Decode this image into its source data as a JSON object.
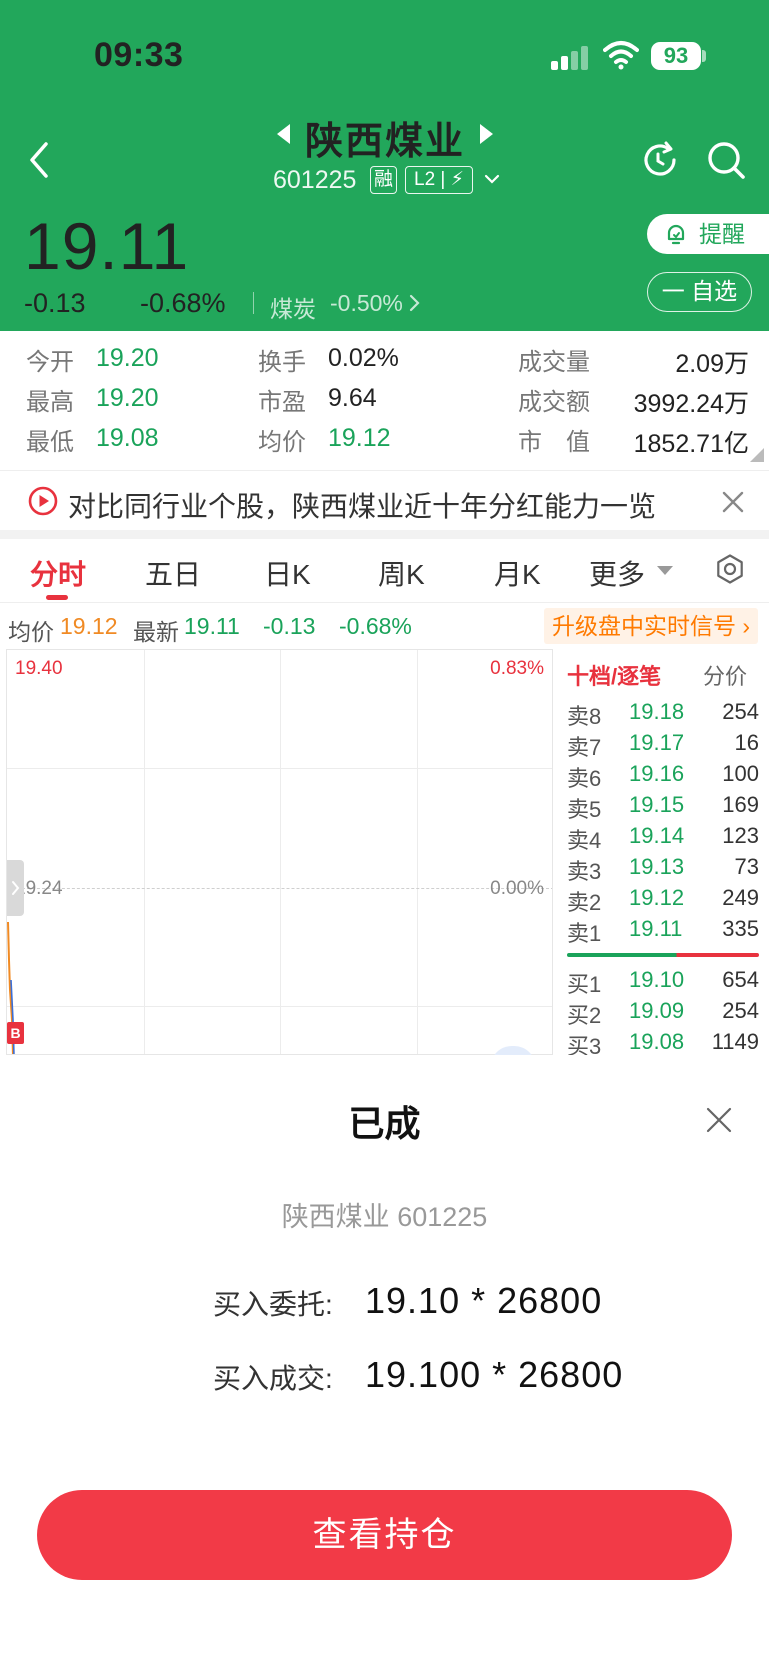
{
  "status_bar": {
    "time": "09:33",
    "battery": "93"
  },
  "header": {
    "stock_name": "陕西煤业",
    "stock_code": "601225",
    "tag_rong": "融",
    "tag_l2": "L2 | ⚡"
  },
  "quote": {
    "price": "19.11",
    "change": "-0.13",
    "change_pct": "-0.68%",
    "industry": "煤炭",
    "industry_pct": "-0.50%",
    "remind_label": "提醒",
    "watchlist_label": "一 自选",
    "colors": {
      "brand_green": "#22a75b",
      "up_red": "#e8323e",
      "down_green": "#1aa35a"
    }
  },
  "stats": [
    {
      "label": "今开",
      "value": "19.20"
    },
    {
      "label": "换手",
      "value": "0.02%"
    },
    {
      "label": "成交量",
      "value": "2.09万"
    },
    {
      "label": "最高",
      "value": "19.20"
    },
    {
      "label": "市盈",
      "value": "9.64"
    },
    {
      "label": "成交额",
      "value": "3992.24万"
    },
    {
      "label": "最低",
      "value": "19.08"
    },
    {
      "label": "均价",
      "value": "19.12"
    },
    {
      "label": "市　值",
      "value": "1852.71亿"
    }
  ],
  "promo": {
    "text": "对比同行业个股，陕西煤业近十年分红能力一览"
  },
  "tabs": [
    "分时",
    "五日",
    "日K",
    "周K",
    "月K",
    "更多"
  ],
  "info_bar": {
    "avg_label": "均价",
    "avg_value": "19.12",
    "latest_label": "最新",
    "latest_value": "19.11",
    "change": "-0.13",
    "change_pct": "-0.68%",
    "upgrade": "升级盘中实时信号"
  },
  "chart": {
    "top_price": "19.40",
    "top_pct": "0.83%",
    "mid_price": "19.24",
    "mid_pct": "0.00%",
    "buy_marker": "B"
  },
  "order_book": {
    "header_left": "十档/逐笔",
    "header_right": "分价",
    "asks": [
      {
        "label": "卖8",
        "price": "19.18",
        "vol": "254"
      },
      {
        "label": "卖7",
        "price": "19.17",
        "vol": "16"
      },
      {
        "label": "卖6",
        "price": "19.16",
        "vol": "100"
      },
      {
        "label": "卖5",
        "price": "19.15",
        "vol": "169"
      },
      {
        "label": "卖4",
        "price": "19.14",
        "vol": "123"
      },
      {
        "label": "卖3",
        "price": "19.13",
        "vol": "73"
      },
      {
        "label": "卖2",
        "price": "19.12",
        "vol": "249"
      },
      {
        "label": "卖1",
        "price": "19.11",
        "vol": "335"
      }
    ],
    "bids": [
      {
        "label": "买1",
        "price": "19.10",
        "vol": "654"
      },
      {
        "label": "买2",
        "price": "19.09",
        "vol": "254"
      },
      {
        "label": "买3",
        "price": "19.08",
        "vol": "1149"
      }
    ]
  },
  "sheet": {
    "title": "已成",
    "subtitle": "陕西煤业 601225",
    "order_label": "买入委托:",
    "order_value": "19.10 * 26800",
    "fill_label": "买入成交:",
    "fill_value": "19.100 * 26800",
    "button": "查看持仓"
  }
}
